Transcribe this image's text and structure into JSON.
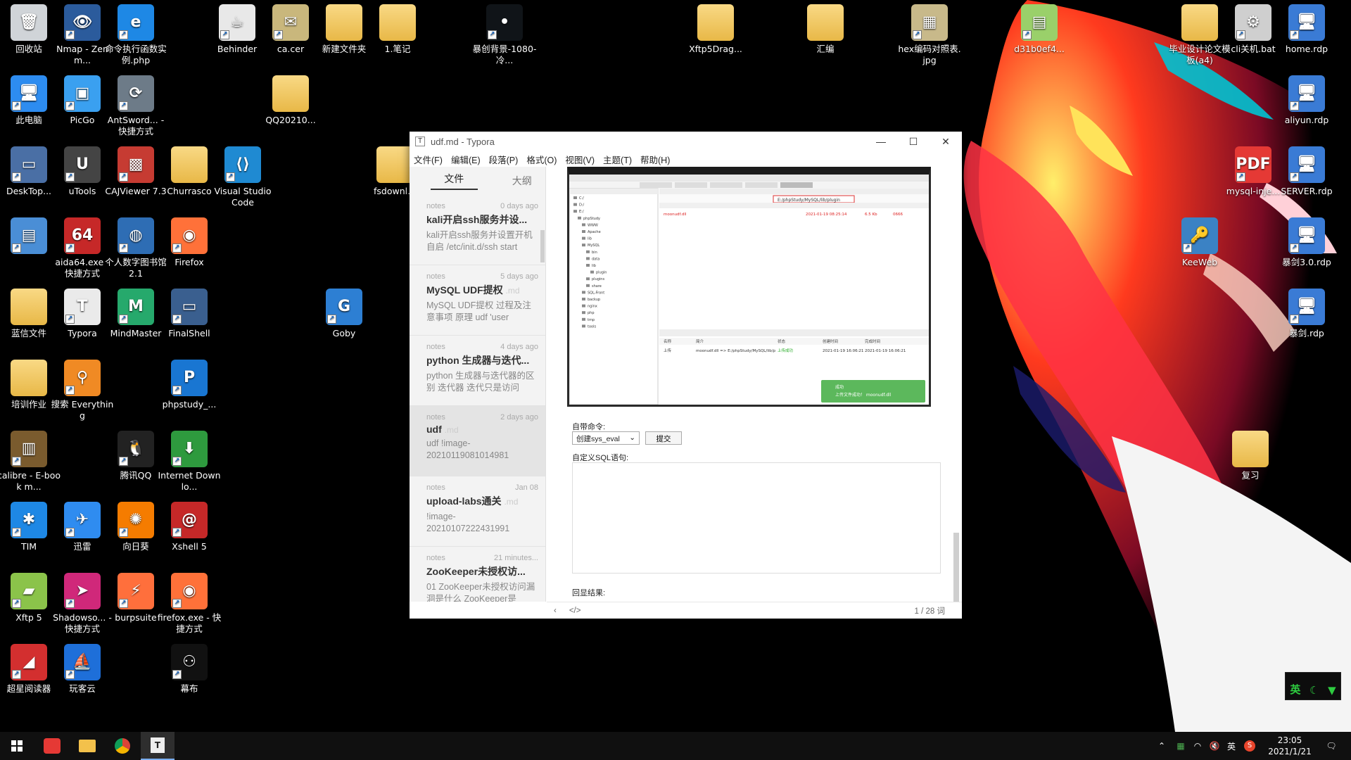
{
  "desktop_icons": [
    {
      "label": "回收站",
      "glyph": "🗑",
      "color": "#d0d4d8",
      "type": "bin"
    },
    {
      "label": "Nmap - Zenm...",
      "glyph": "👁",
      "color": "#2b5b9c",
      "type": "app"
    },
    {
      "label": "命令执行函数实例.php",
      "glyph": "e",
      "color": "#1e88e5",
      "type": "app"
    },
    {
      "label": "Behinder",
      "glyph": "☕",
      "color": "#e8e8e8",
      "type": "app"
    },
    {
      "label": "ca.cer",
      "glyph": "✉",
      "color": "#c9b77c",
      "type": "app"
    },
    {
      "label": "新建文件夹",
      "glyph": "",
      "color": "",
      "type": "folder"
    },
    {
      "label": "1.笔记",
      "glyph": "",
      "color": "",
      "type": "folder"
    },
    {
      "label": "暴创背景-1080-冷...",
      "glyph": "•",
      "color": "#101418",
      "type": "app"
    },
    {
      "label": "Xftp5Drag...",
      "glyph": "",
      "color": "",
      "type": "folder"
    },
    {
      "label": "汇编",
      "glyph": "",
      "color": "",
      "type": "folder"
    },
    {
      "label": "hex编码对照表.jpg",
      "glyph": "▦",
      "color": "#c8b98a",
      "type": "app"
    },
    {
      "label": "d31b0ef4...",
      "glyph": "▤",
      "color": "#9ad06a",
      "type": "app"
    },
    {
      "label": "毕业设计论文模板(a4)",
      "glyph": "",
      "color": "",
      "type": "folder"
    },
    {
      "label": "cli关机.bat",
      "glyph": "⚙",
      "color": "#cfcfcf",
      "type": "app"
    },
    {
      "label": "home.rdp",
      "glyph": "🖥",
      "color": "#3a7bd5",
      "type": "app"
    },
    {
      "label": "此电脑",
      "glyph": "🖥",
      "color": "#2d8cf0",
      "type": "app"
    },
    {
      "label": "PicGo",
      "glyph": "▣",
      "color": "#3aa0f0",
      "type": "app"
    },
    {
      "label": "AntSword... - 快捷方式",
      "glyph": "⟳",
      "color": "#6d7b88",
      "type": "app"
    },
    {
      "label": "QQ20210...",
      "glyph": "",
      "color": "",
      "type": "folder"
    },
    {
      "label": "aliyun.rdp",
      "glyph": "🖥",
      "color": "#3a7bd5",
      "type": "app"
    },
    {
      "label": "DeskTop...",
      "glyph": "▭",
      "color": "#4a6fa5",
      "type": "app"
    },
    {
      "label": "uTools",
      "glyph": "U",
      "color": "#444",
      "type": "app"
    },
    {
      "label": "CAJViewer 7.3",
      "glyph": "▩",
      "color": "#c63b32",
      "type": "app"
    },
    {
      "label": "Churrasco",
      "glyph": "",
      "color": "",
      "type": "folder"
    },
    {
      "label": "Visual Studio Code",
      "glyph": "⟨⟩",
      "color": "#1f8ad2",
      "type": "app"
    },
    {
      "label": "fsdownl...",
      "glyph": "",
      "color": "",
      "type": "folder"
    },
    {
      "label": "mysql-inje...",
      "glyph": "PDF",
      "color": "#e53935",
      "type": "app"
    },
    {
      "label": "SERVER.rdp",
      "glyph": "🖥",
      "color": "#3a7bd5",
      "type": "app"
    },
    {
      "label": "",
      "glyph": "▤",
      "color": "#4a8ed6",
      "type": "app"
    },
    {
      "label": "aida64.exe - 快捷方式",
      "glyph": "64",
      "color": "#c62828",
      "type": "app"
    },
    {
      "label": "个人数字图书馆2.1",
      "glyph": "◍",
      "color": "#2e6db4",
      "type": "app"
    },
    {
      "label": "Firefox",
      "glyph": "◉",
      "color": "#ff7139",
      "type": "app"
    },
    {
      "label": "KeeWeb",
      "glyph": "🔑",
      "color": "#3b82c4",
      "type": "app"
    },
    {
      "label": "暴剑3.0.rdp",
      "glyph": "🖥",
      "color": "#3a7bd5",
      "type": "app"
    },
    {
      "label": "蓝信文件",
      "glyph": "",
      "color": "",
      "type": "folder"
    },
    {
      "label": "Typora",
      "glyph": "T",
      "color": "#eaeaea",
      "type": "app"
    },
    {
      "label": "MindMaster",
      "glyph": "M",
      "color": "#26a96c",
      "type": "app"
    },
    {
      "label": "FinalShell",
      "glyph": "▭",
      "color": "#3a5f8f",
      "type": "app"
    },
    {
      "label": "Goby",
      "glyph": "G",
      "color": "#2d7fd3",
      "type": "app"
    },
    {
      "label": "暴剑.rdp",
      "glyph": "🖥",
      "color": "#3a7bd5",
      "type": "app"
    },
    {
      "label": "培训作业",
      "glyph": "",
      "color": "",
      "type": "folder"
    },
    {
      "label": "搜索 Everything",
      "glyph": "⚲",
      "color": "#f08a24",
      "type": "app"
    },
    {
      "label": "phpstudy_...",
      "glyph": "P",
      "color": "#1976d2",
      "type": "app"
    },
    {
      "label": "calibre - E-book m...",
      "glyph": "▥",
      "color": "#7a5b2e",
      "type": "app"
    },
    {
      "label": "腾讯QQ",
      "glyph": "🐧",
      "color": "#222",
      "type": "app"
    },
    {
      "label": "Internet Downlo...",
      "glyph": "⬇",
      "color": "#2e9a3e",
      "type": "app"
    },
    {
      "label": "复习",
      "glyph": "",
      "color": "",
      "type": "folder"
    },
    {
      "label": "TIM",
      "glyph": "✱",
      "color": "#1e88e5",
      "type": "app"
    },
    {
      "label": "迅雷",
      "glyph": "✈",
      "color": "#2f8cf0",
      "type": "app"
    },
    {
      "label": "向日葵",
      "glyph": "✺",
      "color": "#f57c00",
      "type": "app"
    },
    {
      "label": "Xshell 5",
      "glyph": "@",
      "color": "#c62828",
      "type": "app"
    },
    {
      "label": "Xftp 5",
      "glyph": "▰",
      "color": "#8bc34a",
      "type": "app"
    },
    {
      "label": "Shadowso... - 快捷方式",
      "glyph": "➤",
      "color": "#d0287a",
      "type": "app"
    },
    {
      "label": "burpsuite",
      "glyph": "⚡",
      "color": "#ff6f3c",
      "type": "app"
    },
    {
      "label": "firefox.exe - 快捷方式",
      "glyph": "◉",
      "color": "#ff7139",
      "type": "app"
    },
    {
      "label": "超星阅读器",
      "glyph": "◢",
      "color": "#d32f2f",
      "type": "app"
    },
    {
      "label": "玩客云",
      "glyph": "⛵",
      "color": "#1e6fd9",
      "type": "app"
    },
    {
      "label": "幕布",
      "glyph": "⚇",
      "color": "#111",
      "type": "app"
    }
  ],
  "typora": {
    "title": "udf.md - Typora",
    "menu": [
      "文件(F)",
      "编辑(E)",
      "段落(P)",
      "格式(O)",
      "视图(V)",
      "主题(T)",
      "帮助(H)"
    ],
    "tabs": {
      "files": "文件",
      "outline": "大纲"
    },
    "files": [
      {
        "date": "0 days ago",
        "title": "kali开启ssh服务并设...",
        "ext": "",
        "excerpt": "kali开启ssh服务并设置开机自启 /etc/init.d/ssh start",
        "selected": false
      },
      {
        "date": "5 days ago",
        "title": "MySQL UDF提权",
        "ext": ".md",
        "excerpt": "MySQL UDF提权 过程及注意事项 原理 udf 'user",
        "selected": false
      },
      {
        "date": "4 days ago",
        "title": "python 生成器与迭代...",
        "ext": "",
        "excerpt": "python 生成器与迭代器的区别 迭代器 迭代只是访问",
        "selected": false
      },
      {
        "date": "2 days ago",
        "title": "udf",
        "ext": ".md",
        "excerpt": "udf !image-20210119081014981",
        "selected": true
      },
      {
        "date": "Jan 08",
        "title": "upload-labs通关",
        "ext": ".md",
        "excerpt": "!image-20210107222431991",
        "selected": false
      },
      {
        "date": "21 minutes...",
        "title": "ZooKeeper未授权访...",
        "ext": "",
        "excerpt": "01 ZooKeeper未授权访问漏洞是什么 ZooKeeper是",
        "selected": false
      }
    ],
    "content": {
      "cmd_label": "自带命令:",
      "cmd_value": "创建sys_eval",
      "submit": "提交",
      "sql_label": "自定义SQL语句:",
      "result_label": "回显结果:"
    },
    "word_count": "1 / 28 词",
    "embedded": {
      "path_value": "E:/phpStudy/MySQL/lib/plugin",
      "file_row": [
        "moonudf.dll",
        "2021-01-19 08:25:14",
        "6.5 Kb",
        "0666"
      ],
      "task_header": [
        "名称",
        "简介",
        "状态",
        "创建时间",
        "完成时间"
      ],
      "task_row": [
        "上传",
        "moonudf.dll => E:/phpStudy/MySQL/lib/p",
        "上传成功",
        "2021-01-19 16:06:21",
        "2021-01-19 16:06:21"
      ],
      "toast_title": "成功",
      "toast_msg": "上传文件成功！ moonudf.dll",
      "tree": [
        "C:/",
        "D:/",
        "E:/",
        "phpStudy",
        "WWW",
        "Apache",
        "lib",
        "MySQL",
        "bin",
        "data",
        "lib",
        "plugin",
        "plugins",
        "share",
        "SQL-Front",
        "backup",
        "nginx",
        "php",
        "tmp",
        "tools"
      ]
    }
  },
  "taskbar": {
    "time": "23:05",
    "date": "2021/1/21",
    "ime_lang": "英",
    "tray_lang": "英"
  }
}
